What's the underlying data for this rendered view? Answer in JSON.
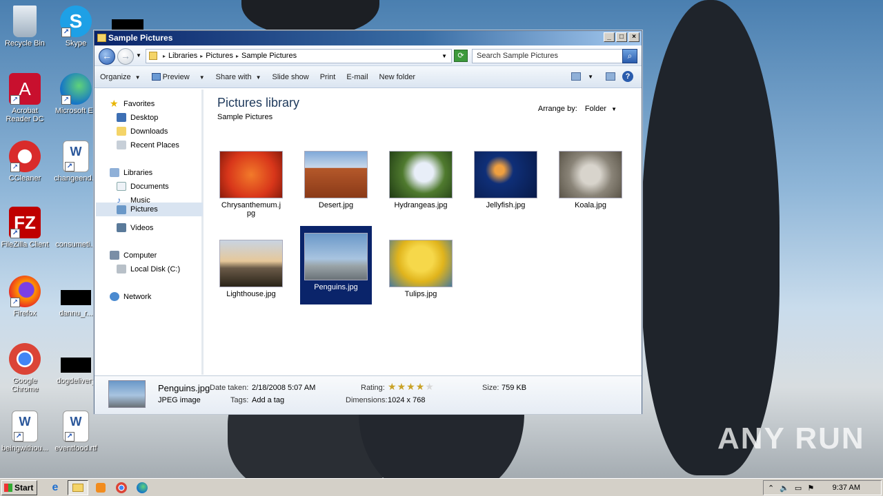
{
  "desktop": {
    "icons": [
      {
        "label": "Recycle Bin",
        "icon": "recycle-bin-icon"
      },
      {
        "label": "Skype",
        "icon": "skype-icon"
      },
      {
        "label": "Acrobat Reader DC",
        "icon": "acrobat-icon"
      },
      {
        "label": "Microsoft Ec",
        "icon": "edge-icon"
      },
      {
        "label": "CCleaner",
        "icon": "ccleaner-icon"
      },
      {
        "label": "changeend...",
        "icon": "word-doc-icon"
      },
      {
        "label": "FileZilla Client",
        "icon": "filezilla-icon"
      },
      {
        "label": "consumeti...",
        "icon": "generic-file-icon"
      },
      {
        "label": "Firefox",
        "icon": "firefox-icon"
      },
      {
        "label": "dannu_r...",
        "icon": "generic-file-icon"
      },
      {
        "label": "Google Chrome",
        "icon": "chrome-icon"
      },
      {
        "label": "dogdelivery",
        "icon": "generic-file-icon"
      },
      {
        "label": "beingwithou...",
        "icon": "word-doc-icon"
      },
      {
        "label": "eventfood.rtf",
        "icon": "word-doc-icon"
      }
    ],
    "watermark": "ANY RUN"
  },
  "window": {
    "title": "Sample Pictures",
    "breadcrumbs": [
      "Libraries",
      "Pictures",
      "Sample Pictures"
    ],
    "search_placeholder": "Search Sample Pictures",
    "toolbar": {
      "organize": "Organize",
      "preview": "Preview",
      "share_with": "Share with",
      "slide_show": "Slide show",
      "print": "Print",
      "email": "E-mail",
      "new_folder": "New folder"
    },
    "nav": {
      "favorites": "Favorites",
      "desktop": "Desktop",
      "downloads": "Downloads",
      "recent_places": "Recent Places",
      "libraries": "Libraries",
      "documents": "Documents",
      "music": "Music",
      "pictures": "Pictures",
      "videos": "Videos",
      "computer": "Computer",
      "local_disk": "Local Disk (C:)",
      "network": "Network"
    },
    "content": {
      "title": "Pictures library",
      "subtitle": "Sample Pictures",
      "arrange_label": "Arrange by:",
      "arrange_value": "Folder",
      "files": [
        {
          "name": "Chrysanthemum.jpg",
          "color": "#d8361a"
        },
        {
          "name": "Desert.jpg",
          "color": "#b4582a"
        },
        {
          "name": "Hydrangeas.jpg",
          "color": "#4f7a2e"
        },
        {
          "name": "Jellyfish.jpg",
          "color": "#0f2f78"
        },
        {
          "name": "Koala.jpg",
          "color": "#8a8478"
        },
        {
          "name": "Lighthouse.jpg",
          "color": "#6a5a48"
        },
        {
          "name": "Penguins.jpg",
          "color": "#6a98c8"
        },
        {
          "name": "Tulips.jpg",
          "color": "#e0b41c"
        }
      ],
      "selected": "Penguins.jpg"
    },
    "details": {
      "filename": "Penguins.jpg",
      "filetype": "JPEG image",
      "date_label": "Date taken:",
      "date_value": "2/18/2008 5:07 AM",
      "tags_label": "Tags:",
      "tags_value": "Add a tag",
      "rating_label": "Rating:",
      "rating": 4,
      "rating_max": 5,
      "dimensions_label": "Dimensions:",
      "dimensions_value": "1024 x 768",
      "size_label": "Size:",
      "size_value": "759 KB"
    }
  },
  "taskbar": {
    "start": "Start",
    "clock": "9:37 AM"
  }
}
